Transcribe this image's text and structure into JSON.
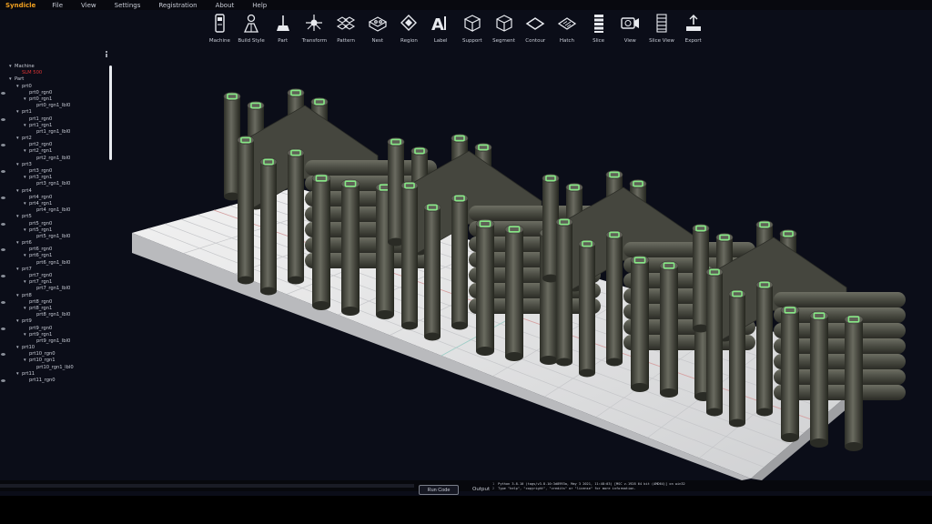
{
  "menubar": {
    "brand": "Syndicle",
    "menus": [
      "File",
      "View",
      "Settings",
      "Registration",
      "About",
      "Help"
    ]
  },
  "toolbar": [
    {
      "label": "Machine",
      "icon": "machine-icon"
    },
    {
      "label": "Build Style",
      "icon": "build-style-icon"
    },
    {
      "label": "Part",
      "icon": "part-icon"
    },
    {
      "label": "Transform",
      "icon": "transform-icon"
    },
    {
      "label": "Pattern",
      "icon": "pattern-icon"
    },
    {
      "label": "Nest",
      "icon": "nest-icon"
    },
    {
      "label": "Region",
      "icon": "region-icon"
    },
    {
      "label": "Label",
      "icon": "label-icon"
    },
    {
      "label": "Support",
      "icon": "support-icon"
    },
    {
      "label": "Segment",
      "icon": "segment-icon"
    },
    {
      "label": "Contour",
      "icon": "contour-icon"
    },
    {
      "label": "Hatch",
      "icon": "hatch-icon"
    },
    {
      "label": "Slice",
      "icon": "slice-icon"
    },
    {
      "label": "View",
      "icon": "view-icon"
    },
    {
      "label": "Slice View",
      "icon": "slice-view-icon"
    },
    {
      "label": "Export",
      "icon": "export-icon"
    }
  ],
  "tree": [
    {
      "label": "Machine",
      "level": 0,
      "arrow": "▾",
      "eye": false
    },
    {
      "label": "SLM 500",
      "level": 1,
      "arrow": "",
      "eye": false,
      "red": true
    },
    {
      "label": "Part",
      "level": 0,
      "arrow": "▾",
      "eye": false
    },
    {
      "label": "prt0",
      "level": 1,
      "arrow": "▾",
      "eye": false
    },
    {
      "label": "prt0_rgn0",
      "level": 2,
      "arrow": "",
      "eye": true
    },
    {
      "label": "prt0_rgn1",
      "level": 2,
      "arrow": "▾",
      "eye": false
    },
    {
      "label": "prt0_rgn1_lbl0",
      "level": 3,
      "arrow": "",
      "eye": false
    },
    {
      "label": "prt1",
      "level": 1,
      "arrow": "▾",
      "eye": false
    },
    {
      "label": "prt1_rgn0",
      "level": 2,
      "arrow": "",
      "eye": true
    },
    {
      "label": "prt1_rgn1",
      "level": 2,
      "arrow": "▾",
      "eye": false
    },
    {
      "label": "prt1_rgn1_lbl0",
      "level": 3,
      "arrow": "",
      "eye": false
    },
    {
      "label": "prt2",
      "level": 1,
      "arrow": "▾",
      "eye": false
    },
    {
      "label": "prt2_rgn0",
      "level": 2,
      "arrow": "",
      "eye": true
    },
    {
      "label": "prt2_rgn1",
      "level": 2,
      "arrow": "▾",
      "eye": false
    },
    {
      "label": "prt2_rgn1_lbl0",
      "level": 3,
      "arrow": "",
      "eye": false
    },
    {
      "label": "prt3",
      "level": 1,
      "arrow": "▾",
      "eye": false
    },
    {
      "label": "prt3_rgn0",
      "level": 2,
      "arrow": "",
      "eye": true
    },
    {
      "label": "prt3_rgn1",
      "level": 2,
      "arrow": "▾",
      "eye": false
    },
    {
      "label": "prt3_rgn1_lbl0",
      "level": 3,
      "arrow": "",
      "eye": false
    },
    {
      "label": "prt4",
      "level": 1,
      "arrow": "▾",
      "eye": false
    },
    {
      "label": "prt4_rgn0",
      "level": 2,
      "arrow": "",
      "eye": true
    },
    {
      "label": "prt4_rgn1",
      "level": 2,
      "arrow": "▾",
      "eye": false
    },
    {
      "label": "prt4_rgn1_lbl0",
      "level": 3,
      "arrow": "",
      "eye": false
    },
    {
      "label": "prt5",
      "level": 1,
      "arrow": "▾",
      "eye": false
    },
    {
      "label": "prt5_rgn0",
      "level": 2,
      "arrow": "",
      "eye": true
    },
    {
      "label": "prt5_rgn1",
      "level": 2,
      "arrow": "▾",
      "eye": false
    },
    {
      "label": "prt5_rgn1_lbl0",
      "level": 3,
      "arrow": "",
      "eye": false
    },
    {
      "label": "prt6",
      "level": 1,
      "arrow": "▾",
      "eye": false
    },
    {
      "label": "prt6_rgn0",
      "level": 2,
      "arrow": "",
      "eye": true
    },
    {
      "label": "prt6_rgn1",
      "level": 2,
      "arrow": "▾",
      "eye": false
    },
    {
      "label": "prt6_rgn1_lbl0",
      "level": 3,
      "arrow": "",
      "eye": false
    },
    {
      "label": "prt7",
      "level": 1,
      "arrow": "▾",
      "eye": false
    },
    {
      "label": "prt7_rgn0",
      "level": 2,
      "arrow": "",
      "eye": true
    },
    {
      "label": "prt7_rgn1",
      "level": 2,
      "arrow": "▾",
      "eye": false
    },
    {
      "label": "prt7_rgn1_lbl0",
      "level": 3,
      "arrow": "",
      "eye": false
    },
    {
      "label": "prt8",
      "level": 1,
      "arrow": "▾",
      "eye": false
    },
    {
      "label": "prt8_rgn0",
      "level": 2,
      "arrow": "",
      "eye": true
    },
    {
      "label": "prt8_rgn1",
      "level": 2,
      "arrow": "▾",
      "eye": false
    },
    {
      "label": "prt8_rgn1_lbl0",
      "level": 3,
      "arrow": "",
      "eye": false
    },
    {
      "label": "prt9",
      "level": 1,
      "arrow": "▾",
      "eye": false
    },
    {
      "label": "prt9_rgn0",
      "level": 2,
      "arrow": "",
      "eye": true
    },
    {
      "label": "prt9_rgn1",
      "level": 2,
      "arrow": "▾",
      "eye": false
    },
    {
      "label": "prt9_rgn1_lbl0",
      "level": 3,
      "arrow": "",
      "eye": false
    },
    {
      "label": "prt10",
      "level": 1,
      "arrow": "▾",
      "eye": false
    },
    {
      "label": "prt10_rgn0",
      "level": 2,
      "arrow": "",
      "eye": true
    },
    {
      "label": "prt10_rgn1",
      "level": 2,
      "arrow": "▾",
      "eye": false
    },
    {
      "label": "prt10_rgn1_lbl0",
      "level": 3,
      "arrow": "",
      "eye": false
    },
    {
      "label": "prt11",
      "level": 1,
      "arrow": "▾",
      "eye": false
    },
    {
      "label": "prt11_rgn0",
      "level": 2,
      "arrow": "",
      "eye": true
    }
  ],
  "bottom": {
    "run_code": "Run Code",
    "output_label": "Output",
    "console_lines": [
      {
        "num": "1",
        "text": "Python 3.8.10 (tags/v3.8.10:3d8993a, May  3 2021, 11:48:03) [MSC v.1928 64 bit (AMD64)] on win32"
      },
      {
        "num": "2",
        "text": "Type \"help\", \"copyright\", \"credits\" or \"license\" for more information."
      }
    ]
  },
  "colors": {
    "brand": "#f0a020",
    "background": "#0b0d18",
    "plate": "#e4e5e7",
    "part": "#4a4b42",
    "label_glow": "#7be07b",
    "highlight_red": "#e03535"
  }
}
